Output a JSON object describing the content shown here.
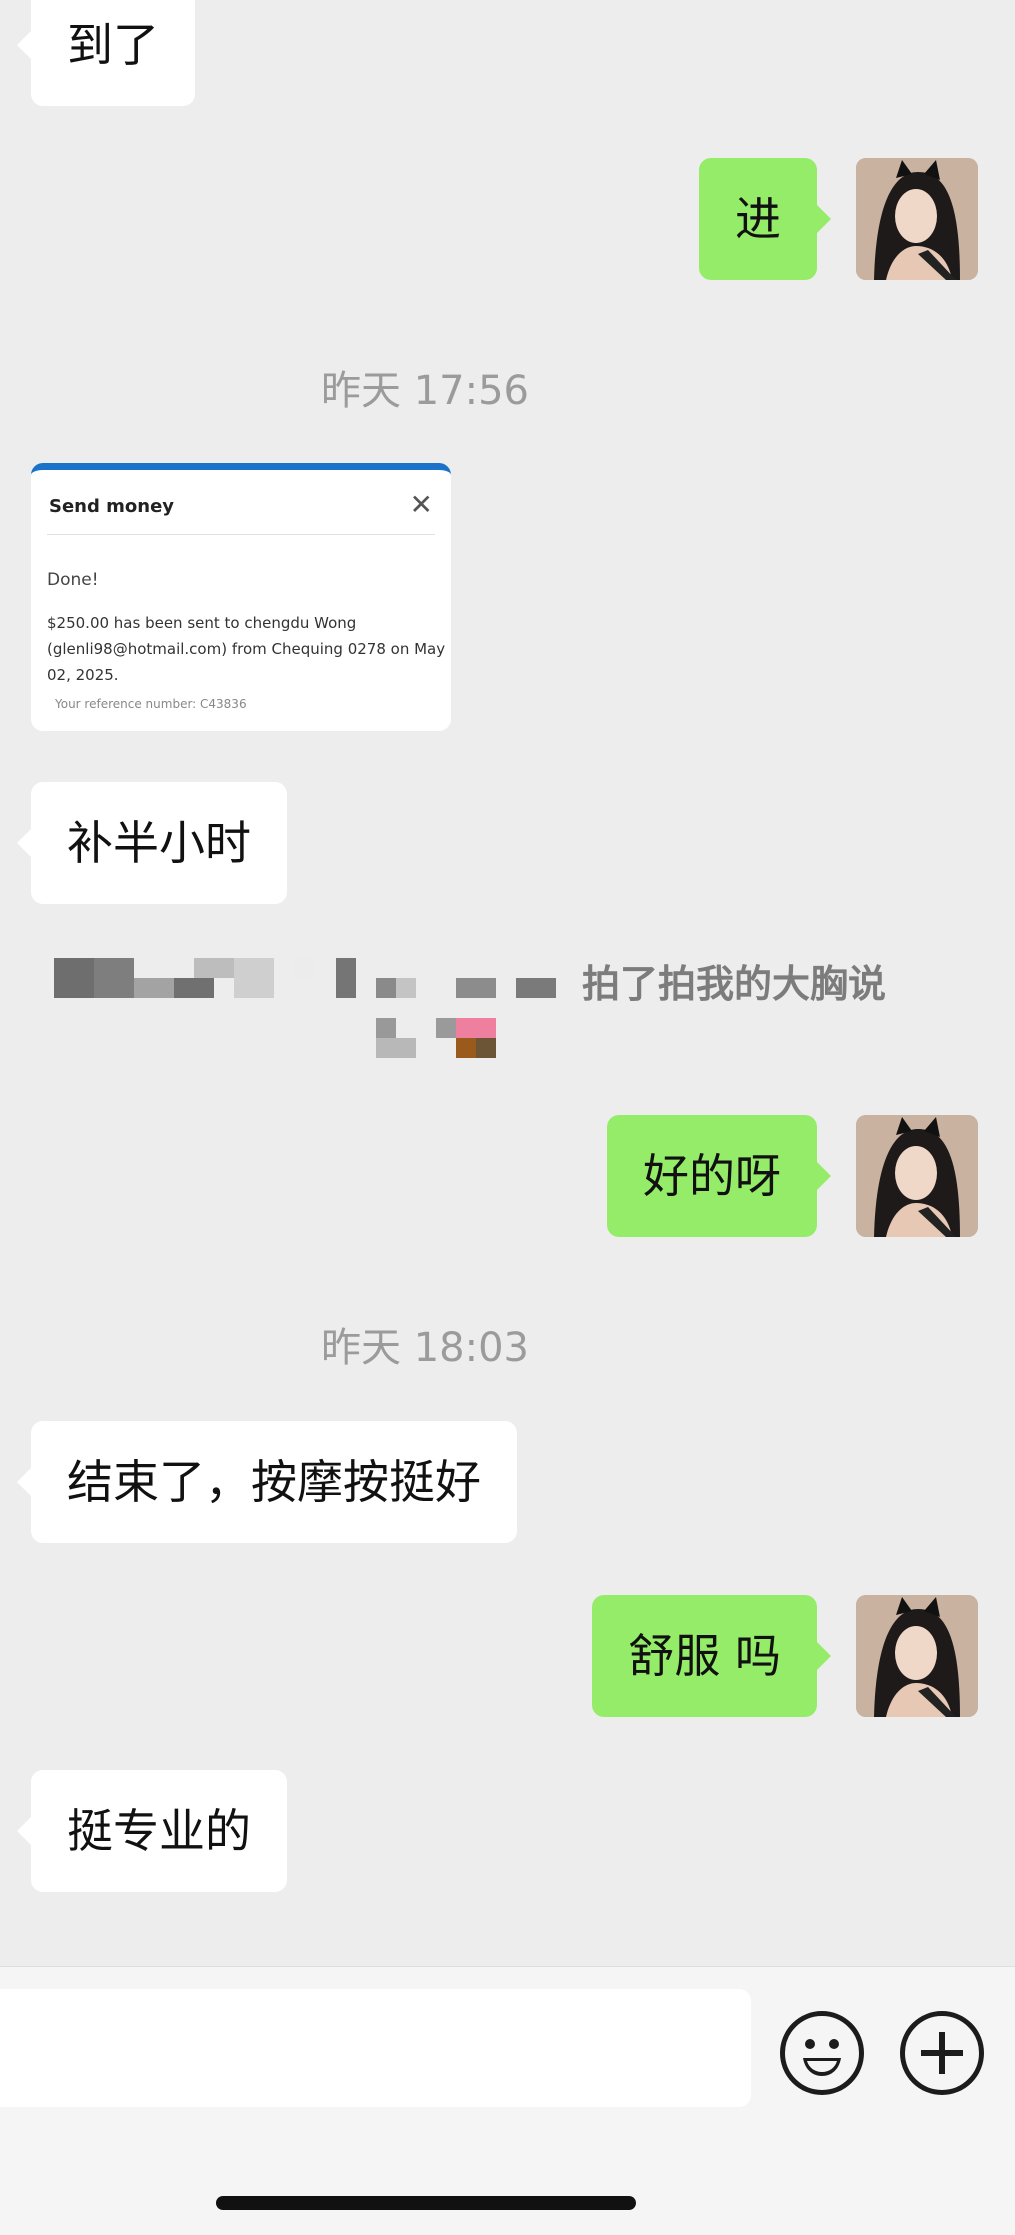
{
  "messages": {
    "m1": "到了",
    "m2": "进",
    "t1": "昨天 17:56",
    "transfer": {
      "header": "Send money",
      "close": "✕",
      "done": "Done!",
      "body": "$250.00 has been sent to chengdu Wong (glenli98@hotmail.com) from Chequing 0278 on May 02, 2025.",
      "reference": "Your reference number: C43836"
    },
    "m3": "补半小时",
    "pat": "拍了拍我的大胸说",
    "m4": "好的呀",
    "t2": "昨天 18:03",
    "m5": "结束了，按摩按挺好",
    "m6": "舒服 吗",
    "m7": "挺专业的"
  },
  "icons": {
    "avatar": "user-avatar",
    "emoji": "smiley-icon",
    "plus": "plus-circle-icon"
  },
  "colors": {
    "outgoing": "#95ec69",
    "incoming": "#ffffff",
    "background": "#ededed"
  }
}
